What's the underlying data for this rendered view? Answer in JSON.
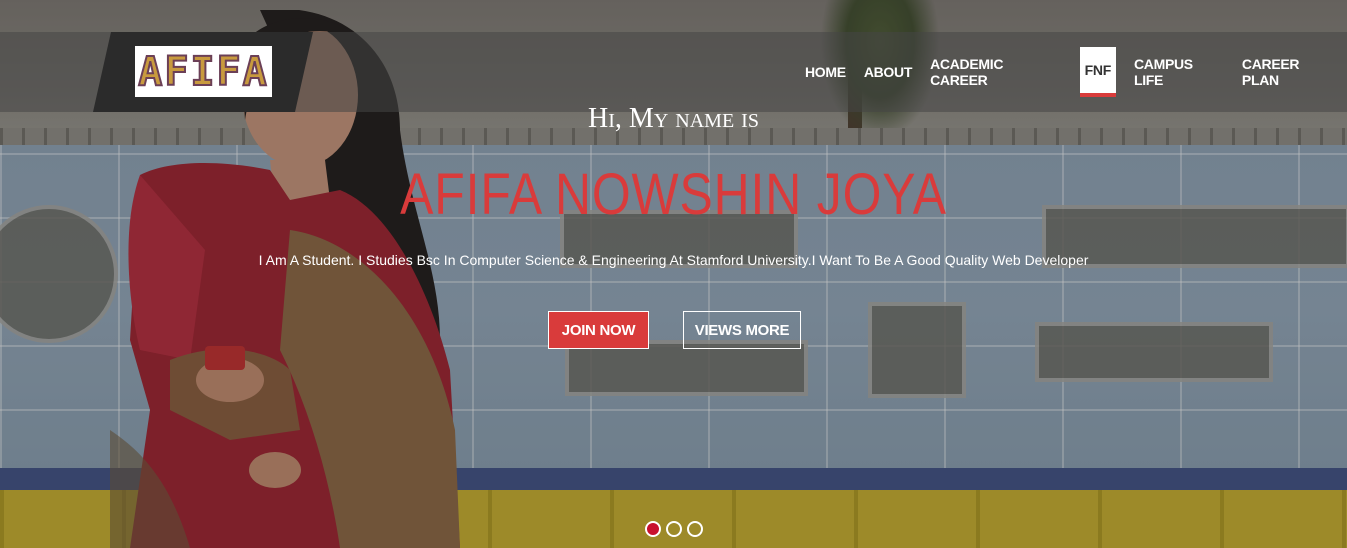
{
  "header": {
    "logo_text": "AFIFA",
    "nav": [
      {
        "label": "HOME"
      },
      {
        "label": "ABOUT"
      },
      {
        "label": "ACADEMIC CAREER"
      },
      {
        "label": "FNF",
        "active": true
      },
      {
        "label": "CAMPUS LIFE"
      },
      {
        "label": "CAREER PLAN"
      }
    ]
  },
  "hero": {
    "greeting": "Hi, My name is",
    "name": "AFIFA NOWSHIN JOYA",
    "tagline": "I Am A Student. I Studies Bsc In Computer Science & Engineering At Stamford University.I Want To Be A Good Quality Web Developer",
    "buttons": {
      "join": "JOIN NOW",
      "views": "VIEWS MORE"
    },
    "slides_active_index": 0
  },
  "colors": {
    "accent": "#d93b3b",
    "header_bg": "#2b2b2b",
    "active_dot": "#c8102e"
  }
}
